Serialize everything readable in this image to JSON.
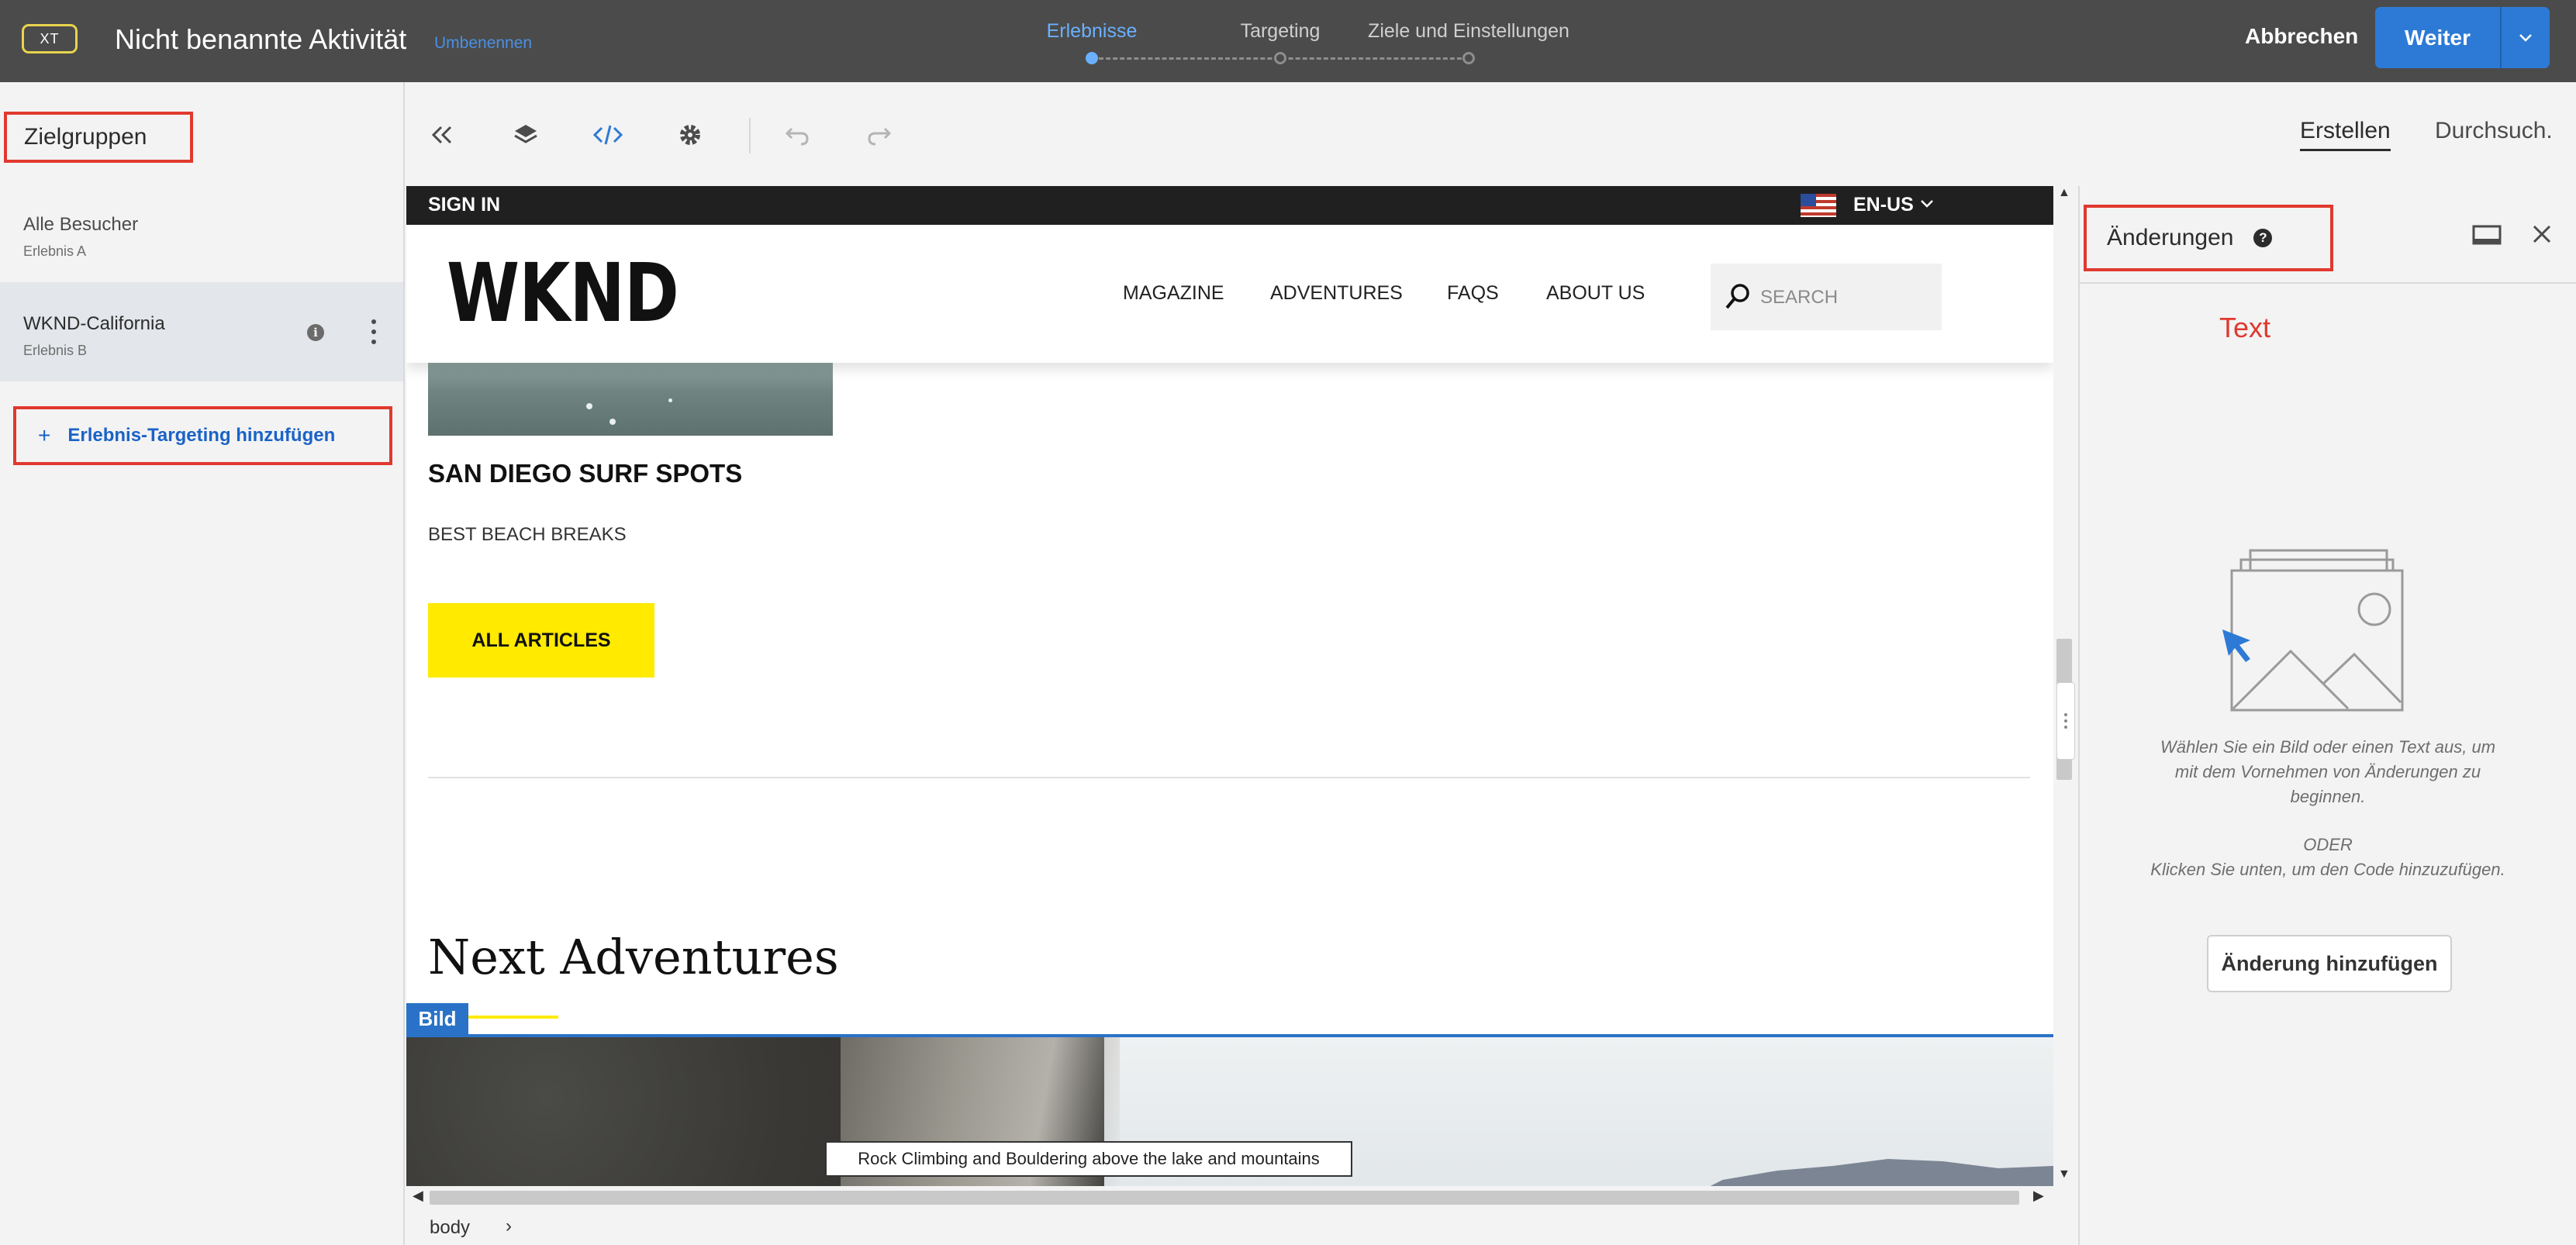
{
  "header": {
    "badge": "XT",
    "activity_title": "Nicht benannte Aktivität",
    "rename_link": "Umbenennen",
    "steps": [
      {
        "label": "Erlebnisse",
        "active": true
      },
      {
        "label": "Targeting",
        "active": false
      },
      {
        "label": "Ziele und Einstellungen",
        "active": false
      }
    ],
    "cancel_label": "Abbrechen",
    "next_label": "Weiter"
  },
  "left_panel": {
    "heading": "Zielgruppen",
    "audiences": [
      {
        "name": "Alle Besucher",
        "experience": "Erlebnis A",
        "selected": false
      },
      {
        "name": "WKND-California",
        "experience": "Erlebnis B",
        "selected": true
      }
    ],
    "add_targeting": "Erlebnis-Targeting hinzufügen",
    "add_icon": "+"
  },
  "toolbar": {
    "icons": [
      "collapse-icon",
      "layers-icon",
      "code-icon",
      "settings-icon",
      "undo-icon",
      "redo-icon"
    ],
    "tabs": [
      {
        "label": "Erstellen",
        "current": true
      },
      {
        "label": "Durchsuch.",
        "current": false
      }
    ]
  },
  "site": {
    "sign_in": "SIGN IN",
    "language": "EN-US",
    "logo": "WKND",
    "nav": [
      "MAGAZINE",
      "ADVENTURES",
      "FAQS",
      "ABOUT US"
    ],
    "search_placeholder": "SEARCH",
    "article_title": "SAN DIEGO SURF SPOTS",
    "article_subtitle": "BEST BEACH BREAKS",
    "all_articles": "ALL ARTICLES",
    "section_title": "Next Adventures",
    "selection_tag": "Bild",
    "image_tooltip": "Rock Climbing and Bouldering above the lake and mountains"
  },
  "breadcrumb": {
    "current": "body",
    "chevron": "›"
  },
  "right_panel": {
    "heading": "Änderungen",
    "help": "?",
    "annotation": "Text",
    "message": "Wählen Sie ein Bild oder einen Text aus, um mit dem Vornehmen von Änderungen zu beginnen.",
    "or": "ODER",
    "message2": "Klicken Sie unten, um den Code hinzuzufügen.",
    "add_change": "Änderung hinzufügen"
  },
  "colors": {
    "header_bg": "#4b4b4b",
    "accent_blue": "#2d7ad6",
    "highlight_red": "#e0392f",
    "wknd_yellow": "#ffea00",
    "active_step": "#6ab0ff"
  }
}
